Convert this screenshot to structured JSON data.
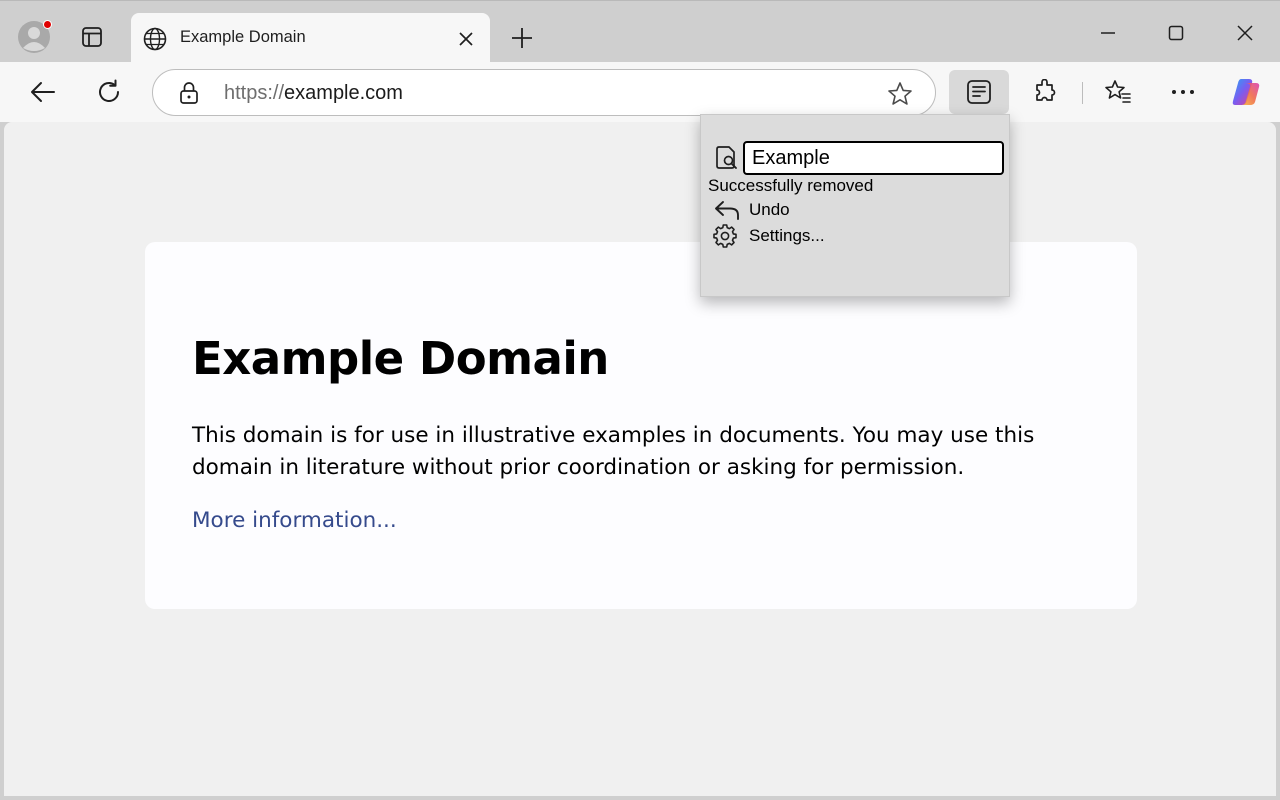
{
  "tab": {
    "title": "Example Domain"
  },
  "address_bar": {
    "scheme": "https://",
    "host": "example.com"
  },
  "page": {
    "heading": "Example Domain",
    "paragraph": "This domain is for use in illustrative examples in documents. You may use this domain in literature without prior coordination or asking for permission.",
    "link_text": "More information..."
  },
  "popup": {
    "search_value": "Example",
    "status": "Successfully removed",
    "undo_label": "Undo",
    "settings_label": "Settings..."
  },
  "colors": {
    "link": "#354a8c",
    "tab_bar": "#cfcfcf",
    "toolbar": "#f7f7f7",
    "popup": "#dcdcdc"
  },
  "icons": [
    "profile-icon",
    "tab-actions-icon",
    "globe-icon",
    "close-icon",
    "plus-icon",
    "minimize-icon",
    "maximize-icon",
    "back-icon",
    "refresh-icon",
    "lock-icon",
    "star-icon",
    "reader-icon",
    "extensions-icon",
    "favorites-icon",
    "more-icon",
    "copilot-icon",
    "find-page-icon",
    "undo-icon",
    "gear-icon"
  ]
}
